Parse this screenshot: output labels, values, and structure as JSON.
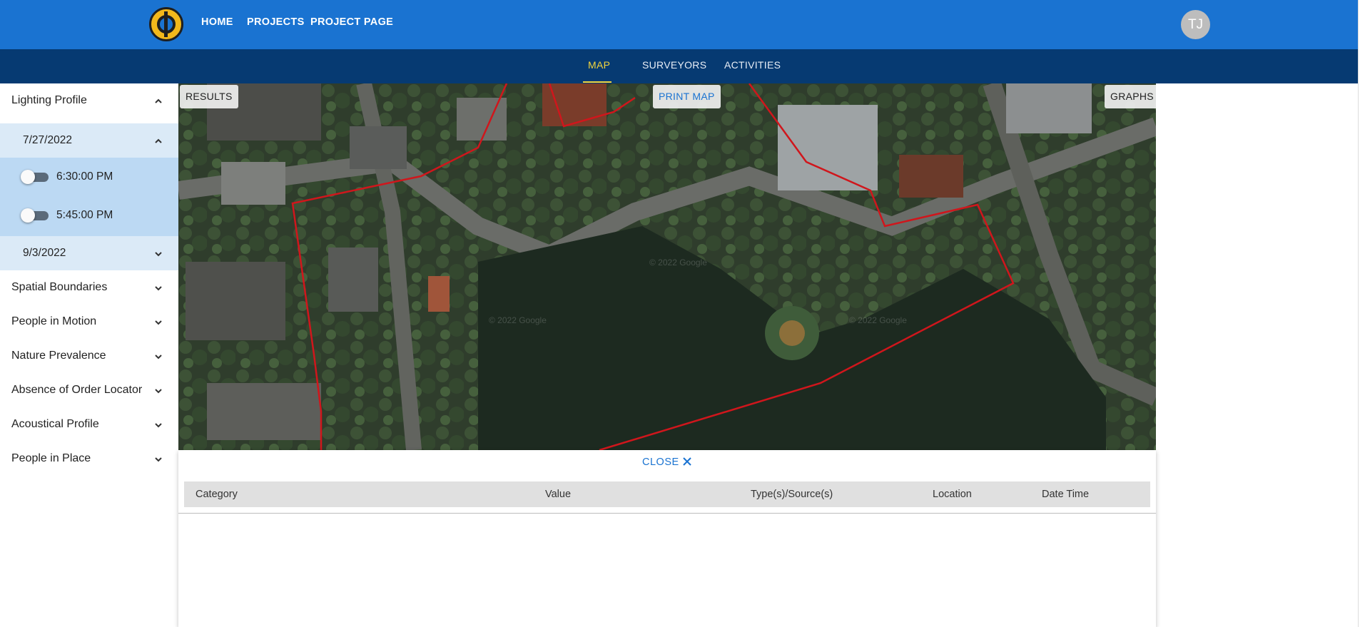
{
  "topbar": {
    "logo": "brand-logo-icon",
    "nav": [
      "HOME",
      "PROJECTS",
      "PROJECT PAGE"
    ],
    "avatar_initials": "TJ",
    "color": "#1a73d1"
  },
  "subnav": {
    "tabs": [
      "MAP",
      "SURVEYORS",
      "ACTIVITIES"
    ],
    "active": "MAP",
    "color": "#063a72",
    "active_color": "#f2d43c"
  },
  "sidebar": {
    "lighting_profile": {
      "label": "Lighting Profile",
      "expanded": true,
      "dates": [
        {
          "label": "7/27/2022",
          "expanded": true,
          "times": [
            {
              "label": "6:30:00 PM",
              "on": false
            },
            {
              "label": "5:45:00 PM",
              "on": false
            }
          ]
        },
        {
          "label": "9/3/2022",
          "expanded": false
        }
      ]
    },
    "sections": [
      "Spatial Boundaries",
      "People in Motion",
      "Nature Prevalence",
      "Absence of Order Locator",
      "Acoustical Profile",
      "People in Place"
    ]
  },
  "map": {
    "buttons": {
      "results": "RESULTS",
      "print": "PRINT MAP",
      "graphs": "GRAPHS"
    },
    "watermarks": [
      "© 2022 Google",
      "© 2022 Google",
      "© 2022 Google"
    ],
    "boundary_color": "#d0161c"
  },
  "results": {
    "close_label": "CLOSE",
    "columns": [
      "Category",
      "Value",
      "Type(s)/Source(s)",
      "Location",
      "Date Time"
    ],
    "rows": []
  }
}
